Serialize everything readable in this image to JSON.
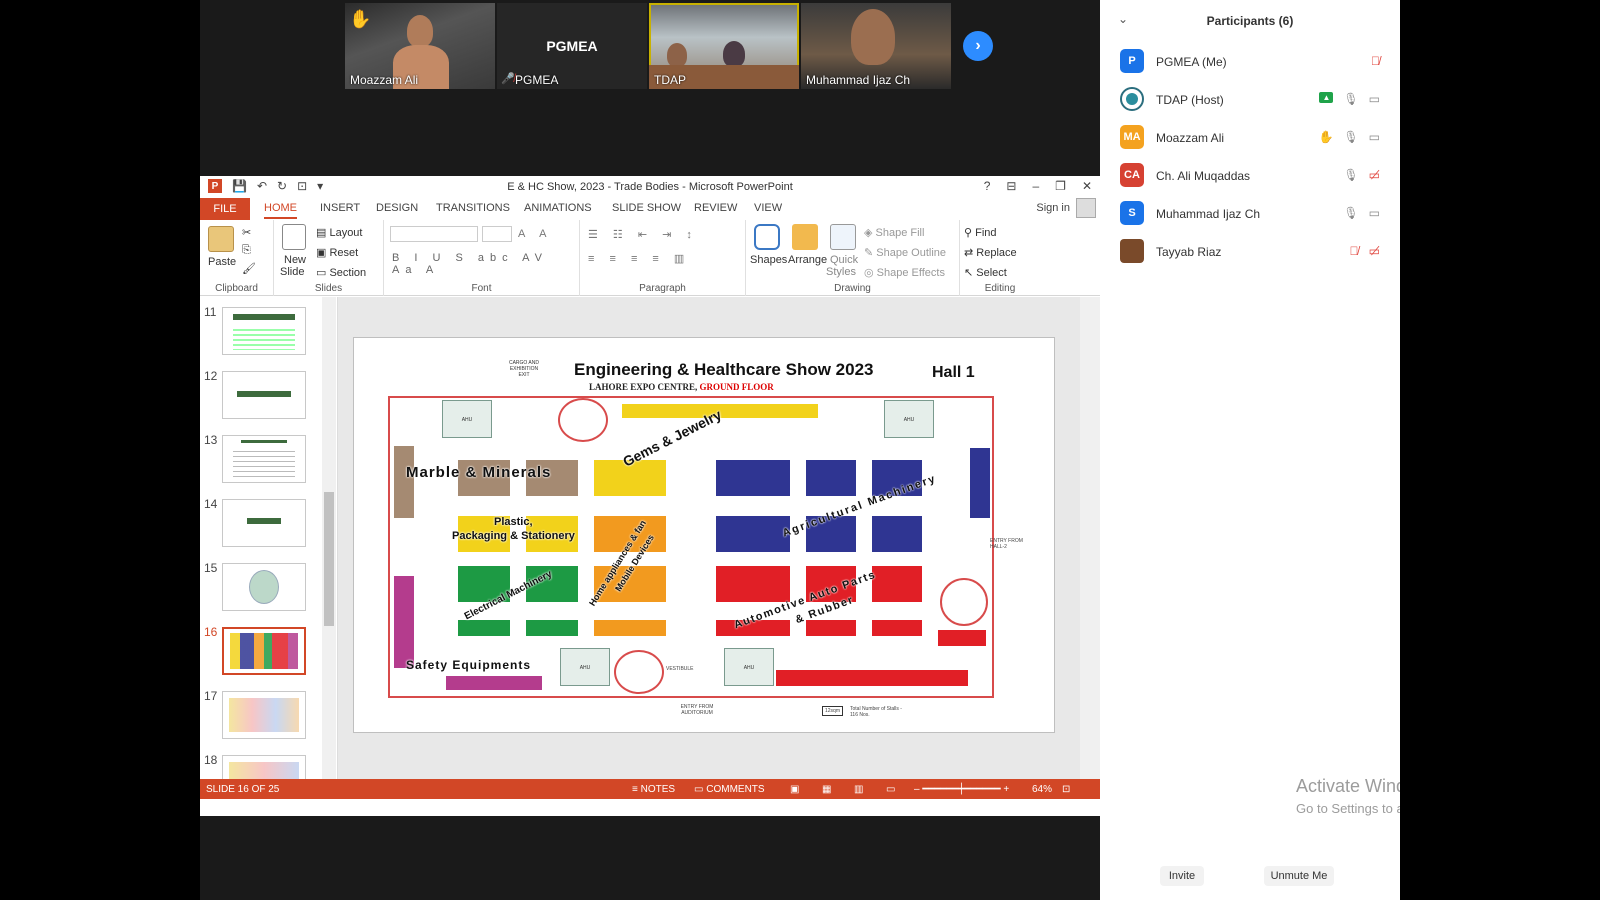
{
  "video": {
    "tiles": [
      {
        "name": "Moazzam Ali"
      },
      {
        "name": "PGMEA",
        "big_name": "PGMEA"
      },
      {
        "name": "TDAP"
      },
      {
        "name": "Muhammad Ijaz Ch"
      }
    ]
  },
  "ppt": {
    "title": "E & HC Show, 2023 - Trade Bodies - Microsoft PowerPoint",
    "tabs": [
      "FILE",
      "HOME",
      "INSERT",
      "DESIGN",
      "TRANSITIONS",
      "ANIMATIONS",
      "SLIDE SHOW",
      "REVIEW",
      "VIEW"
    ],
    "sign_in": "Sign in",
    "ribbon": {
      "clipboard": {
        "name": "Clipboard",
        "paste": "Paste"
      },
      "slides": {
        "name": "Slides",
        "new_slide": "New",
        "new_slide2": "Slide",
        "layout": "Layout",
        "reset": "Reset",
        "section": "Section"
      },
      "font": {
        "name": "Font"
      },
      "paragraph": {
        "name": "Paragraph"
      },
      "drawing": {
        "name": "Drawing",
        "shapes": "Shapes",
        "arrange": "Arrange",
        "quick": "Quick",
        "styles": "Styles",
        "fill": "Shape Fill",
        "outline": "Shape Outline",
        "effects": "Shape Effects"
      },
      "editing": {
        "name": "Editing",
        "find": "Find",
        "replace": "Replace",
        "select": "Select"
      }
    },
    "thumbs": [
      "11",
      "12",
      "13",
      "14",
      "15",
      "16",
      "17",
      "18"
    ],
    "selected_thumb": "16",
    "status": {
      "slide": "SLIDE 16 OF 25",
      "notes": "NOTES",
      "comments": "COMMENTS",
      "zoom": "64%"
    }
  },
  "slide": {
    "title": "Engineering & Healthcare Show 2023",
    "subtitle_a": "LAHORE EXPO CENTRE, ",
    "subtitle_b": "GROUND FLOOR",
    "hall": "Hall 1",
    "cargo": "CARGO AND EXHIBITION EXIT",
    "zones": {
      "gems": "Gems & Jewelry",
      "marble": "Marble & Minerals",
      "plastic1": "Plastic,",
      "plastic2": "Packaging & Stationery",
      "electrical": "Electrical Machinery",
      "home": "Home appliances & fan",
      "home2": "Mobile Devices",
      "agri": "Agricultural Machinery",
      "auto": "Automotive Auto Parts",
      "auto2": "& Rubber",
      "safety": "Safety Equipments"
    },
    "labels": {
      "ahu": "AHU",
      "entry_hall2": "ENTRY FROM HALL-2",
      "entry_aud": "ENTRY FROM AUDITORIUM",
      "vestibule": "VESTIBULE",
      "total": "Total Number of Stalls - 116 Nos.",
      "stall": "12sqm"
    }
  },
  "participants": {
    "title": "Participants (6)",
    "list": [
      {
        "initials": "P",
        "name": "PGMEA (Me)",
        "color": "#1a73e8"
      },
      {
        "initials": "",
        "name": "TDAP (Host)",
        "color": "#2b6e7e"
      },
      {
        "initials": "MA",
        "name": "Moazzam Ali",
        "color": "#f4a21f"
      },
      {
        "initials": "CA",
        "name": "Ch. Ali Muqaddas",
        "color": "#d64132"
      },
      {
        "initials": "S",
        "name": "Muhammad Ijaz Ch",
        "color": "#1a73e8"
      },
      {
        "initials": "",
        "name": "Tayyab Riaz",
        "color": "#7a4a2a"
      }
    ],
    "invite": "Invite",
    "unmute": "Unmute Me"
  },
  "watermark": {
    "line1": "Activate Windows",
    "line2": "Go to Settings to activate Windows."
  }
}
